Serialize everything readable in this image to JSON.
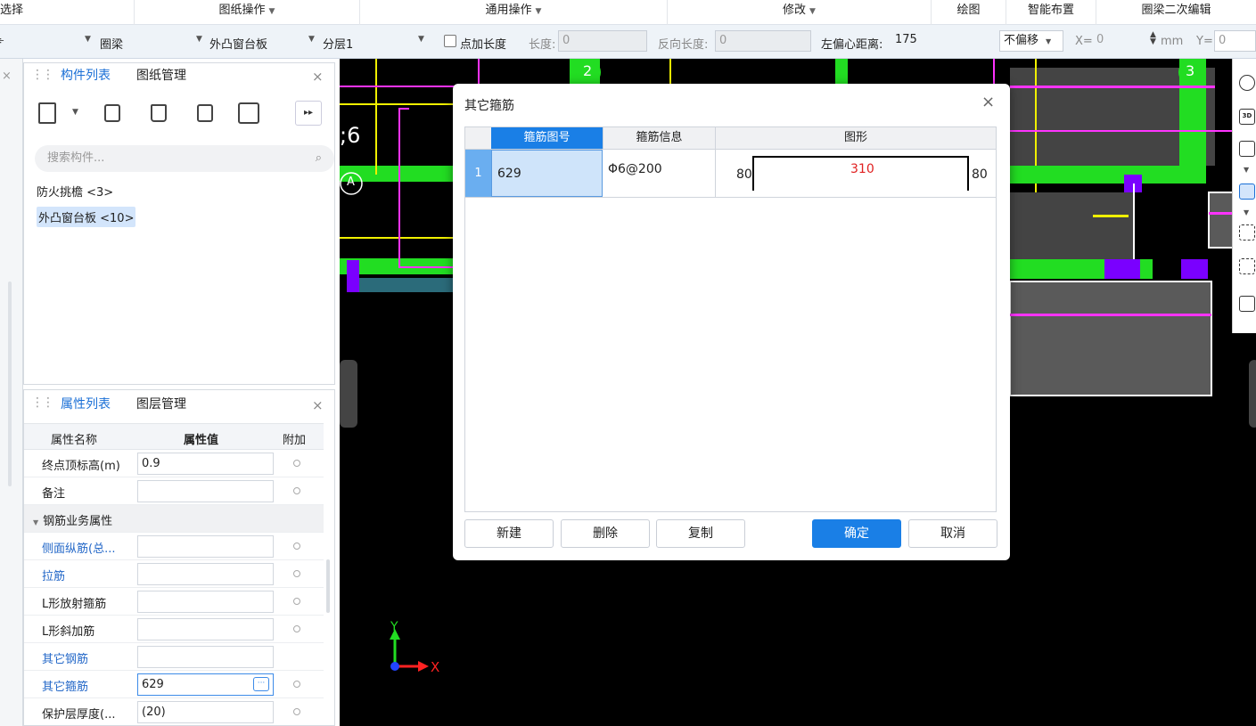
{
  "ribbon": {
    "select": "选择",
    "drawing_ops": "图纸操作",
    "general_ops": "通用操作",
    "modify": "修改",
    "draw": "绘图",
    "smart_layout": "智能布置",
    "ring_beam_edit": "圈梁二次编辑"
  },
  "toolbar": {
    "combo1": "",
    "combo2": "圈梁",
    "combo3": "外凸窗台板",
    "combo4": "分层1",
    "add_length_label": "点加长度",
    "length_label": "长度:",
    "length_value": "0",
    "reverse_length_label": "反向长度:",
    "reverse_length_value": "0",
    "left_offset_label": "左偏心距离:",
    "left_offset_value": "175",
    "no_shift": "不偏移",
    "x_label": "X=",
    "x_value": "0",
    "mm": "mm",
    "y_label": "Y=",
    "y_value": "0"
  },
  "component_panel": {
    "tab_list": "构件列表",
    "tab_drawings": "图纸管理",
    "search_placeholder": "搜索构件...",
    "items": [
      "防火挑檐 <3>",
      "外凸窗台板 <10>"
    ]
  },
  "property_panel": {
    "tab_props": "属性列表",
    "tab_layers": "图层管理",
    "col_name": "属性名称",
    "col_value": "属性值",
    "col_extra": "附加",
    "rows": [
      {
        "name": "终点顶标高(m)",
        "value": "0.9"
      },
      {
        "name": "备注",
        "value": ""
      },
      {
        "name": "钢筋业务属性",
        "value": ""
      },
      {
        "name": "侧面纵筋(总...",
        "value": ""
      },
      {
        "name": "拉筋",
        "value": ""
      },
      {
        "name": "L形放射箍筋",
        "value": ""
      },
      {
        "name": "L形斜加筋",
        "value": ""
      },
      {
        "name": "其它钢筋",
        "value": ""
      },
      {
        "name": "其它箍筋",
        "value": "629"
      },
      {
        "name": "保护层厚度(...",
        "value": "(20)"
      }
    ]
  },
  "canvas": {
    "axis_labels": [
      "2",
      "3",
      "A"
    ],
    "partial_text": ";6",
    "axis_x": "X",
    "axis_y": "Y"
  },
  "dialog": {
    "title": "其它箍筋",
    "columns": [
      "箍筋图号",
      "箍筋信息",
      "图形"
    ],
    "row": {
      "index": "1",
      "code": "629",
      "info": "Φ6@200",
      "shape_left": "80",
      "shape_mid": "310",
      "shape_right": "80"
    },
    "buttons": {
      "new": "新建",
      "delete": "删除",
      "copy": "复制",
      "ok": "确定",
      "cancel": "取消"
    }
  },
  "colors": {
    "accent": "#1a7fe6",
    "green": "#22dd22",
    "yellow": "#f0f000",
    "magenta": "#ff33ff",
    "purple": "#7a00ff"
  }
}
